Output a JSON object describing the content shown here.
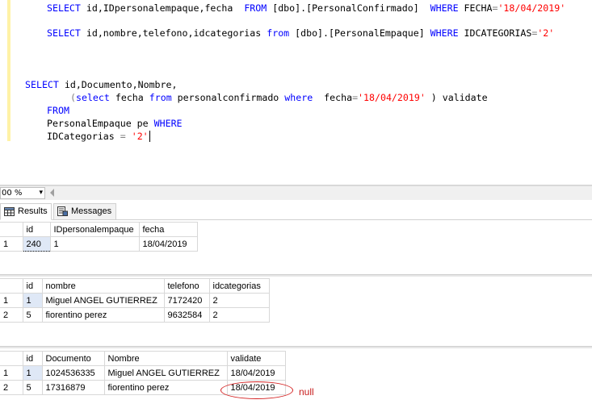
{
  "editor": {
    "line1": {
      "a": "SELECT",
      "b": " id,IDpersonalempaque,fecha  ",
      "c": "FROM",
      "d": " [dbo].[PersonalConfirmado]  ",
      "e": "WHERE",
      "f": " FECHA",
      "g": "=",
      "h": "'18/04/2019'"
    },
    "line2": {
      "a": "SELECT",
      "b": " id,nombre,telefono,idcategorias ",
      "c": "from",
      "d": " [dbo].[PersonalEmpaque] ",
      "e": "WHERE",
      "f": " IDCATEGORIAS",
      "g": "=",
      "h": "'2'"
    },
    "line3": {
      "a": "SELECT",
      "b": " id,Documento,Nombre,"
    },
    "line4": {
      "a": "(",
      "b": "select",
      "c": " fecha ",
      "d": "from",
      "e": " personalconfirmado ",
      "f": "where",
      "g": "  fecha",
      "h": "=",
      "i": "'18/04/2019'",
      "j": " ) validate"
    },
    "line5": {
      "a": "FROM"
    },
    "line6": {
      "a": "PersonalEmpaque pe ",
      "b": "WHERE"
    },
    "line7": {
      "a": "IDCategorias ",
      "b": "=",
      "c": " '2'"
    }
  },
  "zoom": {
    "value": "00 %",
    "arrow": "▾"
  },
  "tabs": {
    "results": "Results",
    "messages": "Messages"
  },
  "grid1": {
    "headers": [
      "id",
      "IDpersonalempaque",
      "fecha"
    ],
    "rows": [
      {
        "num": "1",
        "cells": [
          "240",
          "1",
          "18/04/2019"
        ]
      }
    ]
  },
  "grid2": {
    "headers": [
      "id",
      "nombre",
      "telefono",
      "idcategorias"
    ],
    "rows": [
      {
        "num": "1",
        "cells": [
          "1",
          "Miguel ANGEL GUTIERREZ",
          "7172420",
          "2"
        ]
      },
      {
        "num": "2",
        "cells": [
          "5",
          "fiorentino perez",
          "9632584",
          "2"
        ]
      }
    ]
  },
  "grid3": {
    "headers": [
      "id",
      "Documento",
      "Nombre",
      "validate"
    ],
    "rows": [
      {
        "num": "1",
        "cells": [
          "1",
          "1024536335",
          "Miguel ANGEL GUTIERREZ",
          "18/04/2019"
        ]
      },
      {
        "num": "2",
        "cells": [
          "5",
          "17316879",
          "fiorentino perez",
          "18/04/2019"
        ]
      }
    ]
  },
  "annotation": {
    "text": "null",
    "color": "#c81e1e"
  },
  "colors": {
    "keyword": "#0000ff",
    "string": "#ff0000",
    "operator": "#808080",
    "selected_cell": "#dfe8f6"
  }
}
